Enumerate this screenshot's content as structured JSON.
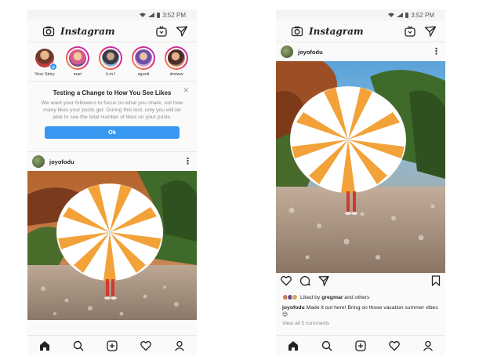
{
  "status_time": "3:52 PM",
  "app_logo": "Instagram",
  "icons": {
    "camera": "camera-icon",
    "igtv": "igtv-icon",
    "direct": "direct-message-icon",
    "more": "more-options-icon",
    "heart": "heart-icon",
    "comment": "comment-icon",
    "share": "share-icon",
    "bookmark": "bookmark-icon",
    "home": "home-icon",
    "search": "search-icon",
    "add": "add-post-icon",
    "activity": "activity-heart-icon",
    "profile": "profile-icon"
  },
  "colors": {
    "accent": "#3897f0",
    "ring_start": "#f9a231",
    "ring_end": "#b231c8"
  },
  "stories": [
    {
      "name": "Your Story"
    },
    {
      "name": "mari"
    },
    {
      "name": "k.m.l"
    },
    {
      "name": "sgunti"
    },
    {
      "name": "dreiww"
    }
  ],
  "notice": {
    "title": "Testing a Change to How You See Likes",
    "body": "We want your followers to focus on what you share, not how many likes your posts get. During this test, only you will be able to see the total number of likes on your posts.",
    "ok_label": "Ok"
  },
  "post": {
    "username": "joyofodu",
    "liked_by_prefix": "Liked by ",
    "liked_by_user": "gregmar",
    "liked_by_suffix": " and others",
    "caption_user": "joyofodu",
    "caption_text": " Made it out here! Bring on those vacation summer vibes 😊",
    "view_comments": "View all 5 comments"
  }
}
